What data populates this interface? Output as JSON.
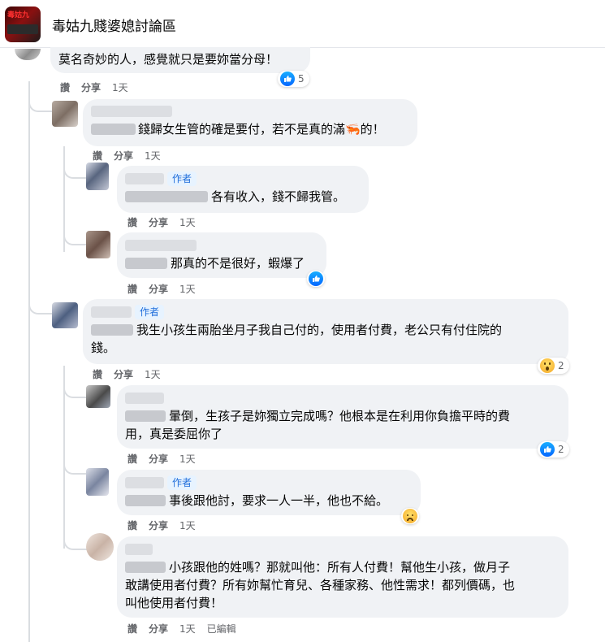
{
  "group": {
    "title": "毒姑九賤婆媳討論區",
    "logo_text": "毒姑九"
  },
  "actions": {
    "like": "讚",
    "reply": "分享",
    "time": "1天",
    "edited": "已編輯"
  },
  "author_tag": "作者",
  "comments": [
    {
      "text": "莫名奇妙的人，感覺就只是要妳當分母！",
      "reaction": {
        "icon": "like-icon",
        "count": "5"
      }
    },
    {
      "text": "錢歸女生管的確是要付，若不是真的滿🦐的！"
    },
    {
      "text": "各有收入，錢不歸我管。",
      "is_author": true
    },
    {
      "text": "那真的不是很好，蝦爆了",
      "reaction": {
        "icon": "like-icon",
        "count": ""
      }
    },
    {
      "line1": "我生小孩生兩胎坐月子我自己付的，使用者付費，老公只有付住院的",
      "line2": "錢。",
      "is_author": true,
      "reaction": {
        "icon": "wow-icon",
        "count": "2"
      }
    },
    {
      "line1": "暈倒，生孩子是妳獨立完成嗎？他根本是在利用你負擔平時的費",
      "line2": "用，真是委屈你了",
      "reaction": {
        "icon": "like-icon",
        "count": "2"
      }
    },
    {
      "text": "事後跟他討，要求一人一半，他也不給。",
      "is_author": true,
      "reaction": {
        "icon": "sad-icon",
        "count": ""
      }
    },
    {
      "line1": "小孩跟他的姓嗎？那就叫他：所有人付費！幫他生小孩，做月子",
      "line2": "敢講使用者付費？所有妳幫忙育兒、各種家務、他性需求！都列價碼，也",
      "line3": "叫他使用者付費！"
    }
  ]
}
